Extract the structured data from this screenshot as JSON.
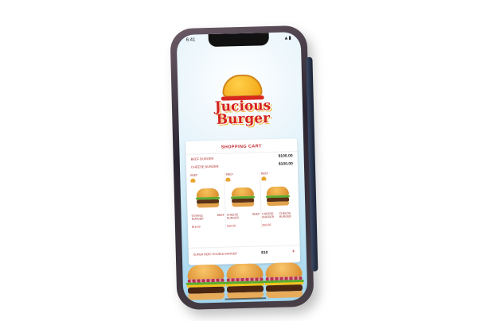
{
  "status_bar": {
    "time": "6:41"
  },
  "brand": {
    "line1": "Jucious",
    "line2": "Burger"
  },
  "cart": {
    "title": "SHOPPING CART",
    "rows": [
      {
        "label": "BEEF BURGER",
        "price": "$100.00"
      },
      {
        "label": "CHEESE BURGER",
        "price": "$100.00"
      }
    ],
    "items": [
      {
        "name": "BEEF",
        "desc_left": "DOUBLE BURGER",
        "desc_right": "BEEF",
        "price": "$18.00"
      },
      {
        "name": "BEEF",
        "desc_left": "CHEESE BURGER",
        "desc_right": "BEEF",
        "price": "$18.00"
      },
      {
        "name": "BEEF",
        "desc_left": "CHEESE BURGER",
        "desc_right": "CHEESE BURGER",
        "price": "$18.00"
      }
    ],
    "footer": {
      "label": "SUPER BEEF DOUBLE BURGER",
      "price": "$10",
      "plus": "+"
    }
  }
}
